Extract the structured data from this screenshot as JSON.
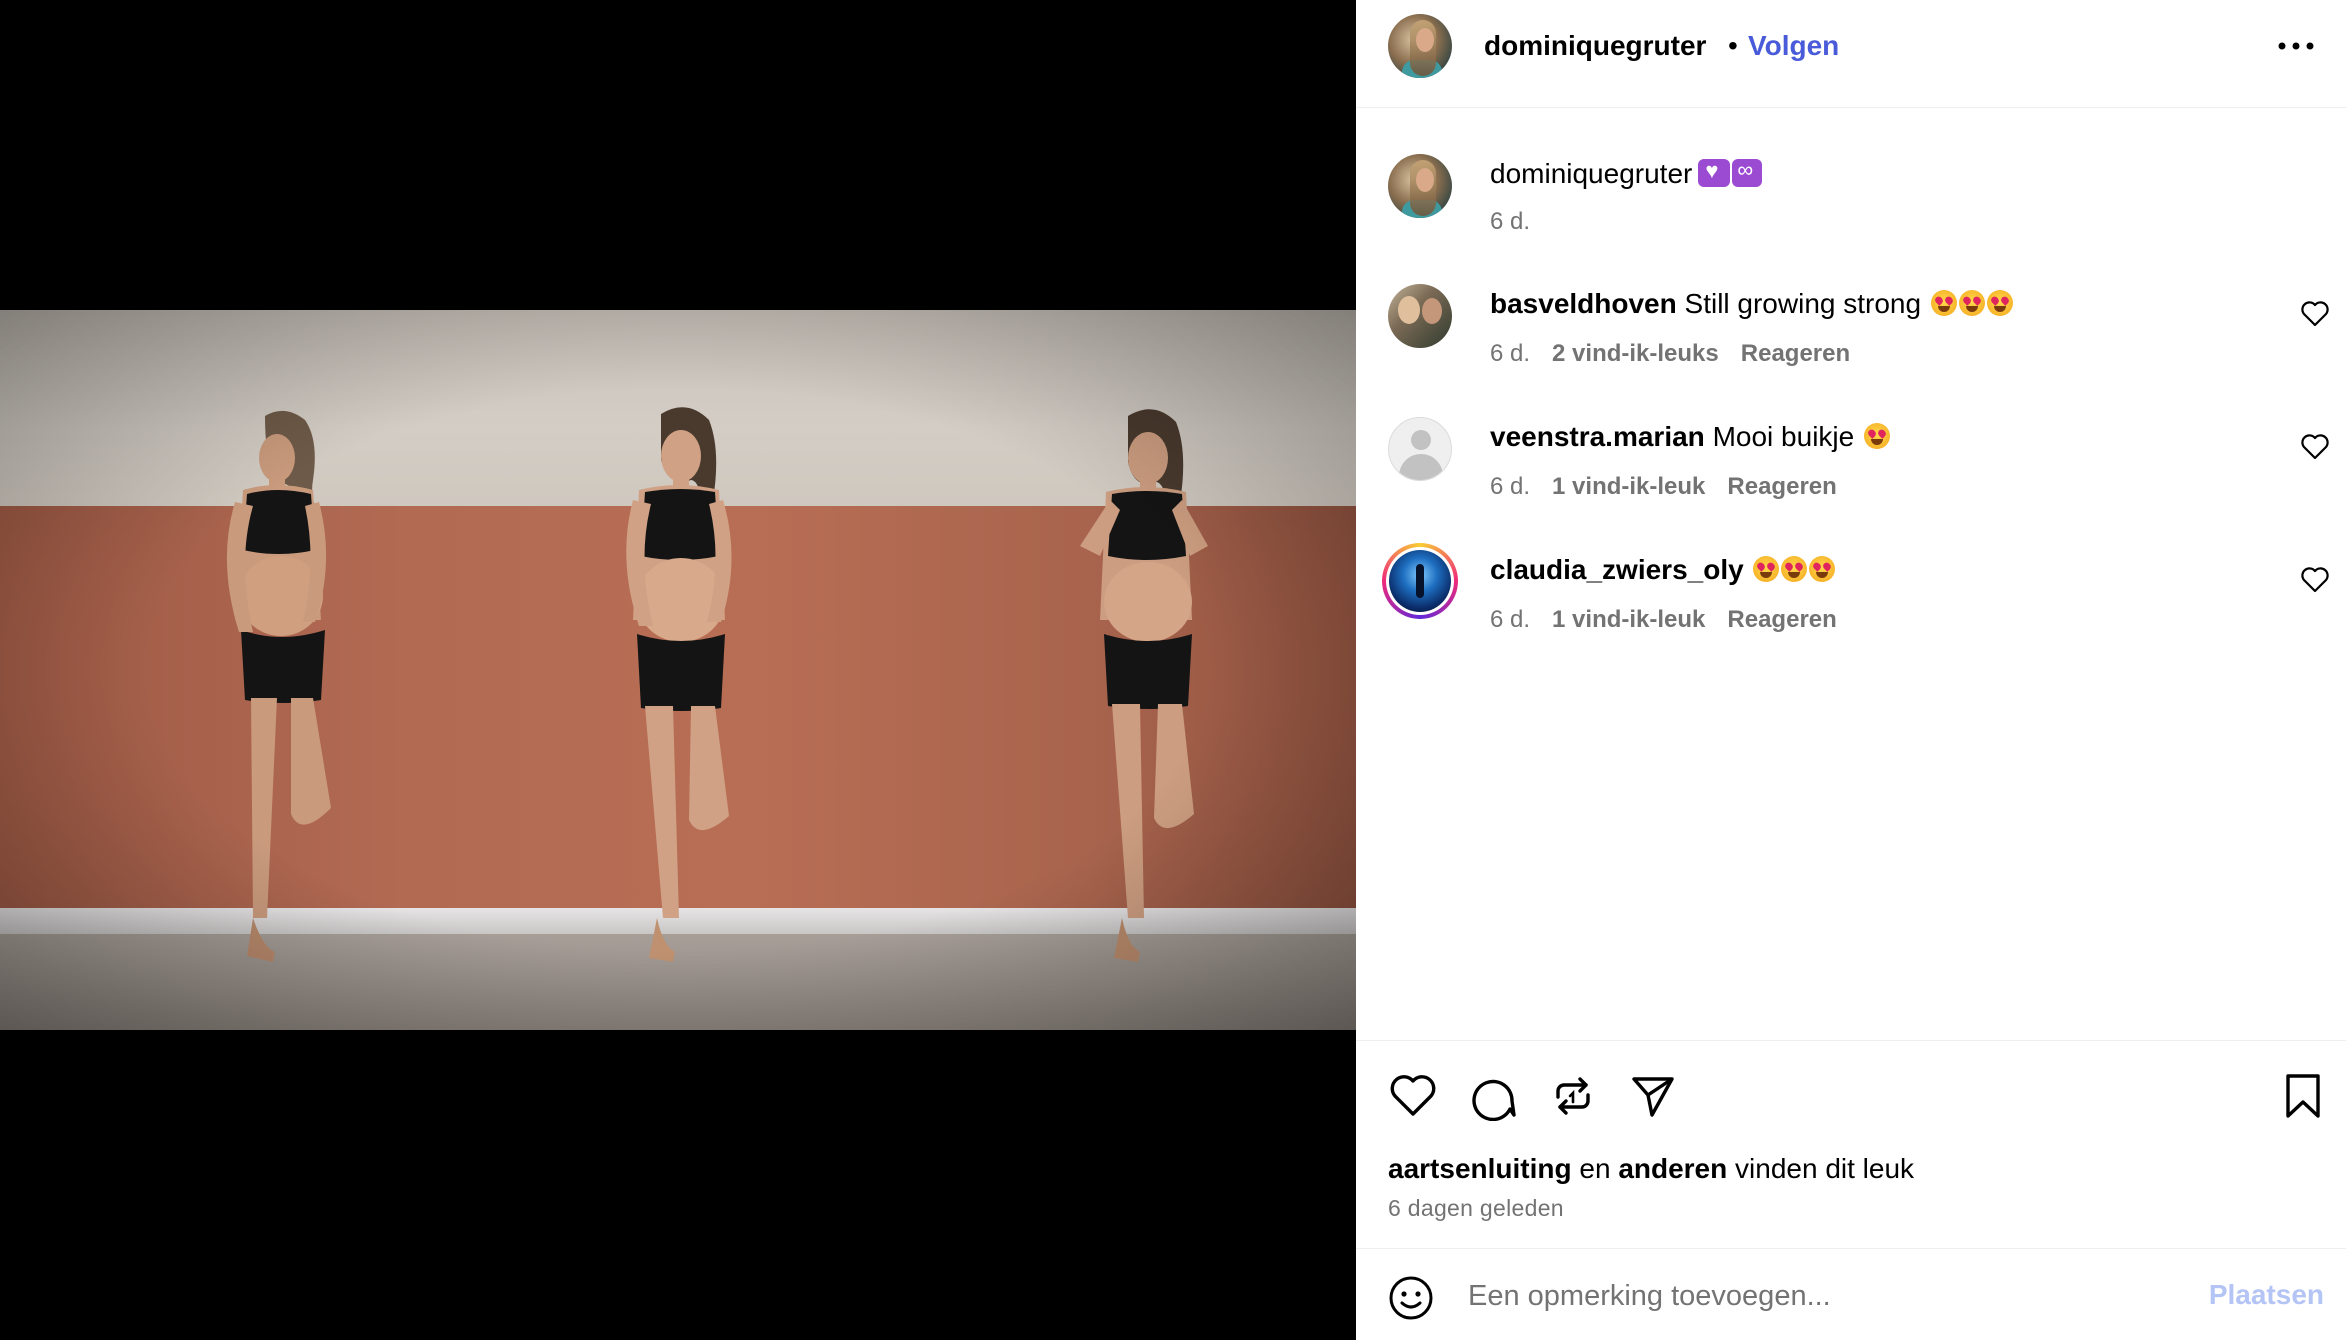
{
  "post": {
    "author": "dominiquegruter",
    "separator": "•",
    "follow_label": "Volgen",
    "more_icon": "more-horizontal-icon"
  },
  "caption": {
    "user": "dominiquegruter",
    "time": "6 d."
  },
  "comments": [
    {
      "user": "basveldhoven",
      "text": "Still growing strong",
      "emoji_count": 3,
      "time": "6 d.",
      "likes": "2 vind-ik-leuks",
      "reply": "Reageren"
    },
    {
      "user": "veenstra.marian",
      "text": "Mooi buikje",
      "emoji_count": 1,
      "time": "6 d.",
      "likes": "1 vind-ik-leuk",
      "reply": "Reageren"
    },
    {
      "user": "claudia_zwiers_oly",
      "text": "",
      "emoji_count": 3,
      "time": "6 d.",
      "likes": "1 vind-ik-leuk",
      "reply": "Reageren"
    }
  ],
  "actions": {
    "icons": [
      "heart-icon",
      "comment-icon",
      "repost-icon",
      "share-icon",
      "bookmark-icon"
    ]
  },
  "likes": {
    "user": "aartsenluiting",
    "and": "en",
    "others": "anderen",
    "suffix": "vinden dit leuk"
  },
  "posted": "6 dagen geleden",
  "add_comment": {
    "placeholder": "Een opmerking toevoegen...",
    "submit_label": "Plaatsen"
  },
  "colors": {
    "link": "#4a5bd9",
    "muted": "#737373",
    "submit_disabled": "#b3c4f5",
    "wall": "#b26a53"
  }
}
